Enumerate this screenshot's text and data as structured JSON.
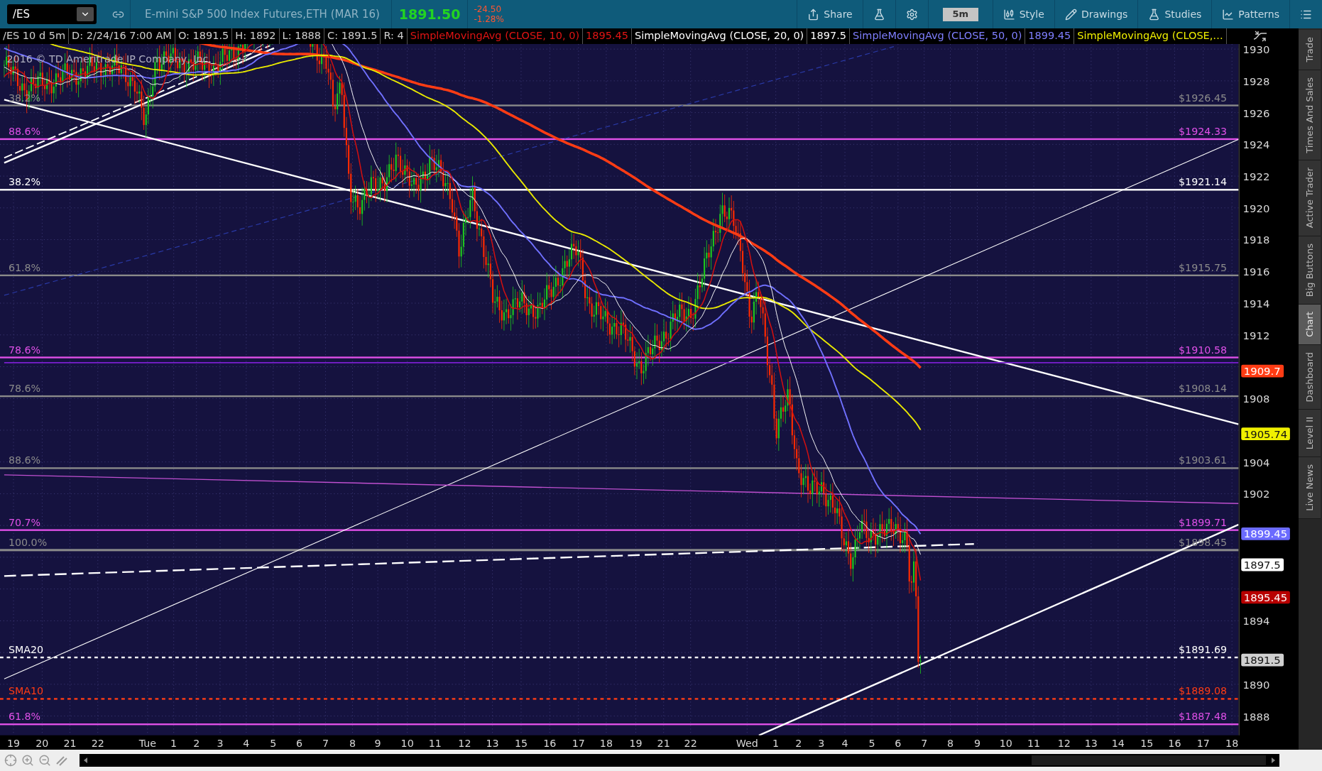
{
  "toolbar": {
    "symbol": "/ES",
    "description": "E-mini S&P 500 Index Futures,ETH (MAR 16)",
    "last_price": "1891.50",
    "net_change": "-24.50",
    "percent_change": "-1.28%",
    "buttons": [
      {
        "kind": "share",
        "label": "Share"
      },
      {
        "kind": "flask"
      },
      {
        "kind": "gear"
      },
      {
        "kind": "aggregation",
        "label": "5m"
      },
      {
        "kind": "style",
        "label": "Style"
      },
      {
        "kind": "drawings",
        "label": "Drawings"
      },
      {
        "kind": "studies",
        "label": "Studies"
      },
      {
        "kind": "patterns",
        "label": "Patterns"
      },
      {
        "kind": "menu"
      }
    ]
  },
  "info_bar": {
    "fields": [
      "/ES 10 d 5m",
      "D: 2/24/16 7:00 AM",
      "O: 1891.5",
      "H: 1892",
      "L: 1888",
      "C: 1891.5",
      "R: 4"
    ],
    "studies": [
      {
        "text": "SimpleMovingAvg (CLOSE, 10, 0)",
        "kind": "sma10"
      },
      {
        "text": "1895.45",
        "kind": "sma10"
      },
      {
        "text": "SimpleMovingAvg (CLOSE, 20, 0)",
        "kind": "sma20"
      },
      {
        "text": "1897.5",
        "kind": "sma20"
      },
      {
        "text": "SimpleMovingAvg (CLOSE, 50, 0)",
        "kind": "sma50"
      },
      {
        "text": "1899.45",
        "kind": "sma50"
      },
      {
        "text": "SimpleMovingAvg (CLOSE,…",
        "kind": "sma100"
      }
    ]
  },
  "chart": {
    "copyright": "2016 © TD Ameritrade IP Company, Inc.",
    "levels": [
      {
        "label": "38.2%",
        "price": "$1926.45",
        "color": "#8a8a8a",
        "dashed": false
      },
      {
        "label": "88.6%",
        "price": "$1924.33",
        "color": "#e050e8",
        "dashed": false
      },
      {
        "label": "38.2%",
        "price": "$1921.14",
        "color": "#ffffff",
        "dashed": false
      },
      {
        "label": "61.8%",
        "price": "$1915.75",
        "color": "#8a8a8a",
        "dashed": false
      },
      {
        "label": "78.6%",
        "price": "$1910.58",
        "color": "#e050e8",
        "dashed": false
      },
      {
        "label": "78.6%",
        "price": "$1908.14",
        "color": "#8a8a8a",
        "dashed": false
      },
      {
        "label": "88.6%",
        "price": "$1903.61",
        "color": "#8a8a8a",
        "dashed": false
      },
      {
        "label": "70.7%",
        "price": "$1899.71",
        "color": "#e050e8",
        "dashed": false
      },
      {
        "label": "100.0%",
        "price": "$1898.45",
        "color": "#8a8a8a",
        "dashed": false
      },
      {
        "label": "SMA20",
        "price": "$1891.69",
        "color": "#ffffff",
        "dashed": true
      },
      {
        "label": "SMA10",
        "price": "$1889.08",
        "color": "#ff3c14",
        "dashed": true
      },
      {
        "label": "61.8%",
        "price": "$1887.48",
        "color": "#e050e8",
        "dashed": false
      }
    ],
    "price_ticks": [
      "1930",
      "1928",
      "1926",
      "1924",
      "1922",
      "1920",
      "1918",
      "1916",
      "1914",
      "1912",
      "1908",
      "1904",
      "1902",
      "1894",
      "1890",
      "1888"
    ],
    "axis_badges": [
      {
        "text": "1909.7",
        "color": "#ff3c14"
      },
      {
        "text": "1905.74",
        "color": "#f0f000"
      },
      {
        "text": "1899.45",
        "color": "#6b6bff"
      },
      {
        "text": "1897.5",
        "color": "#ffffff"
      },
      {
        "text": "1895.45",
        "color": "#b80000"
      },
      {
        "text": "1891.5",
        "color": "#d0d0d0"
      }
    ],
    "time_ticks": [
      "19",
      "20",
      "21",
      "22",
      "Tue",
      "1",
      "2",
      "3",
      "4",
      "5",
      "6",
      "7",
      "8",
      "9",
      "10",
      "11",
      "12",
      "13",
      "15",
      "16",
      "17",
      "18",
      "19",
      "21",
      "22",
      "Wed",
      "1",
      "2",
      "3",
      "4",
      "5",
      "6",
      "7",
      "8",
      "9",
      "10",
      "11",
      "12",
      "13",
      "14",
      "15",
      "16",
      "17",
      "18"
    ]
  },
  "side_tabs": [
    {
      "label": "Trade",
      "selected": false
    },
    {
      "label": "Times And Sales",
      "selected": false
    },
    {
      "label": "Active Trader",
      "selected": false
    },
    {
      "label": "Big Buttons",
      "selected": false
    },
    {
      "label": "Chart",
      "selected": true
    },
    {
      "label": "Dashboard",
      "selected": false
    },
    {
      "label": "Level II",
      "selected": false
    },
    {
      "label": "Live News",
      "selected": false
    }
  ]
}
